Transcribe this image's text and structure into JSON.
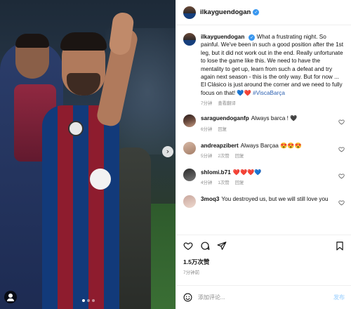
{
  "post": {
    "username": "ilkayguendogan",
    "caption_text": "What a frustrating night. So painful. We've been in such a good position after the 1st leg, but it did not work out in the end. Really unfortunate to lose the game like this. We need to have the mentality to get up, learn from such a defeat and try again next season - this is the only way. But for now ... El Clásico is just around the corner and we need to fully focus on that! 💙❤️",
    "caption_hashtag": "#ViscaBarça",
    "caption_time": "7分钟",
    "caption_translate": "查看翻译",
    "likes": "1.5万次赞",
    "time_ago": "7分钟前"
  },
  "comments": [
    {
      "username": "saraguendoganfp",
      "text": "Always barca ! 🖤",
      "time": "6分钟",
      "likes": "",
      "reply": "回复"
    },
    {
      "username": "andreapzibert",
      "text": "Always Barçaa 😍😍😍",
      "time": "5分钟",
      "likes": "2次赞",
      "reply": "回复"
    },
    {
      "username": "shlomi.b71",
      "text": "❤️❤️❤️💙",
      "time": "4分钟",
      "likes": "1次赞",
      "reply": "回复"
    },
    {
      "username": "3moq3",
      "text": "You destroyed us, but we will still love you",
      "time": "",
      "likes": "",
      "reply": ""
    }
  ],
  "add_comment": {
    "placeholder": "添加评论...",
    "post_label": "发布"
  },
  "icons": {
    "verified": "verified-badge",
    "heart": "heart-icon",
    "comment": "comment-icon",
    "share": "share-icon",
    "save": "bookmark-icon",
    "emoji": "emoji-icon",
    "next": "chevron-right-icon"
  },
  "colors": {
    "verified": "#3897f0",
    "hashtag": "#2b5fb0",
    "muted": "#8e8e8e",
    "post_button": "#b3dbff"
  }
}
